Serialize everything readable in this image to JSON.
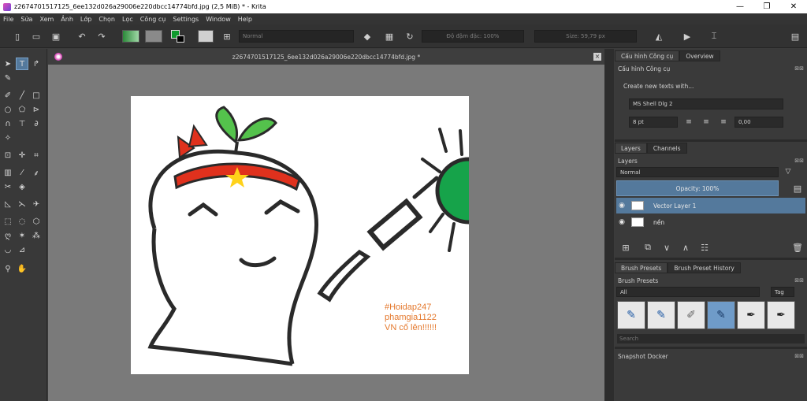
{
  "window": {
    "title": "z2674701517125_6ee132d026a29006e220dbcc14774bfd.jpg (2,5 MiB)  * - Krita",
    "minimize": "—",
    "maximize": "❐",
    "close": "✕"
  },
  "menu": [
    "File",
    "Sửa",
    "Xem",
    "Ảnh",
    "Lớp",
    "Chọn",
    "Lọc",
    "Công cụ",
    "Settings",
    "Window",
    "Help"
  ],
  "toolbar": {
    "blend_mode": "Normal",
    "opacity_label": "Độ đậm đặc: 100%",
    "size_label": "Size: 59,79 px"
  },
  "document": {
    "tab_title": "z2674701517125_6ee132d026a29006e220dbcc14774bfd.jpg *",
    "canvas_text": [
      "#Hoidap247",
      "phamgia1122",
      "VN cố lên!!!!!!"
    ]
  },
  "tool_options": {
    "tabs": [
      "Cấu hình Công cụ",
      "Overview"
    ],
    "header": "Cấu hình Công cụ",
    "create_text_label": "Create new texts with...",
    "font": "MS Shell Dlg 2",
    "font_size": "8 pt",
    "spacing": "0,00"
  },
  "layers": {
    "tabs": [
      "Layers",
      "Channels"
    ],
    "header": "Layers",
    "blend_mode": "Normal",
    "opacity": "Opacity:  100%",
    "items": [
      {
        "name": "Vector Layer 1"
      },
      {
        "name": "nền"
      }
    ]
  },
  "brush_presets": {
    "tabs": [
      "Brush Presets",
      "Brush Preset History"
    ],
    "header": "Brush Presets",
    "filter": "All",
    "tag": "Tag",
    "search_placeholder": "Search"
  },
  "snapshot": {
    "header": "Snapshot Docker"
  }
}
